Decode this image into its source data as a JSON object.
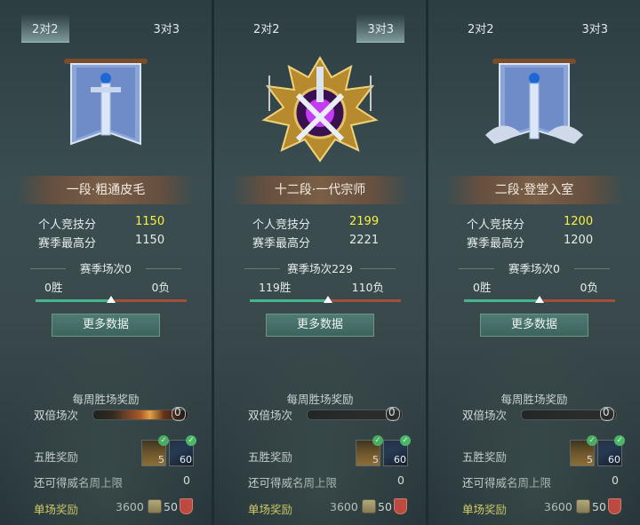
{
  "panels": [
    {
      "tabs": {
        "left": "2对2",
        "right": "3对3",
        "active": "left"
      },
      "emblem": "blue-sword-banner",
      "rank_title": "一段·粗通皮毛",
      "personal_score_label": "个人竞技分",
      "personal_score": "1150",
      "season_best_label": "赛季最高分",
      "season_best": "1150",
      "season_matches_label": "赛季场次0",
      "wins": "0胜",
      "losses": "0负",
      "ratio_marker": 0.5,
      "more_button": "更多数据",
      "weekly_title": "每周胜场奖励",
      "double_label": "双倍场次",
      "double_count": "0",
      "double_fire": true,
      "five_win_label": "五胜奖励",
      "item1_count": "5",
      "item2_count": "60",
      "limit_label": "还可得威名周上限",
      "limit_value": "0",
      "single_label": "单场奖励",
      "single_amount": "3600",
      "single_amount2": "50"
    },
    {
      "tabs": {
        "left": "2对2",
        "right": "3对3",
        "active": "right"
      },
      "emblem": "gold-crowned-crest",
      "rank_title": "十二段·一代宗师",
      "personal_score_label": "个人竞技分",
      "personal_score": "2199",
      "season_best_label": "赛季最高分",
      "season_best": "2221",
      "season_matches_label": "赛季场次229",
      "wins": "119胜",
      "losses": "110负",
      "ratio_marker": 0.52,
      "more_button": "更多数据",
      "weekly_title": "每周胜场奖励",
      "double_label": "双倍场次",
      "double_count": "0",
      "double_fire": false,
      "five_win_label": "五胜奖励",
      "item1_count": "5",
      "item2_count": "60",
      "limit_label": "还可得威名周上限",
      "limit_value": "0",
      "single_label": "单场奖励",
      "single_amount": "3600",
      "single_amount2": "50"
    },
    {
      "tabs": {
        "left": "2对2",
        "right": "3对3",
        "active": "right"
      },
      "emblem": "blue-sword-banner-cloud",
      "rank_title": "二段·登堂入室",
      "personal_score_label": "个人竞技分",
      "personal_score": "1200",
      "season_best_label": "赛季最高分",
      "season_best": "1200",
      "season_matches_label": "赛季场次0",
      "wins": "0胜",
      "losses": "0负",
      "ratio_marker": 0.5,
      "more_button": "更多数据",
      "weekly_title": "每周胜场奖励",
      "double_label": "双倍场次",
      "double_count": "0",
      "double_fire": false,
      "five_win_label": "五胜奖励",
      "item1_count": "5",
      "item2_count": "60",
      "limit_label": "还可得威名周上限",
      "limit_value": "0",
      "single_label": "单场奖励",
      "single_amount": "3600",
      "single_amount2": "50"
    }
  ],
  "colors": {
    "score_highlight": "#f7f23c",
    "win_bar": "#46b58b",
    "loss_bar": "#a24f3c",
    "single_label": "#f3e76a"
  }
}
